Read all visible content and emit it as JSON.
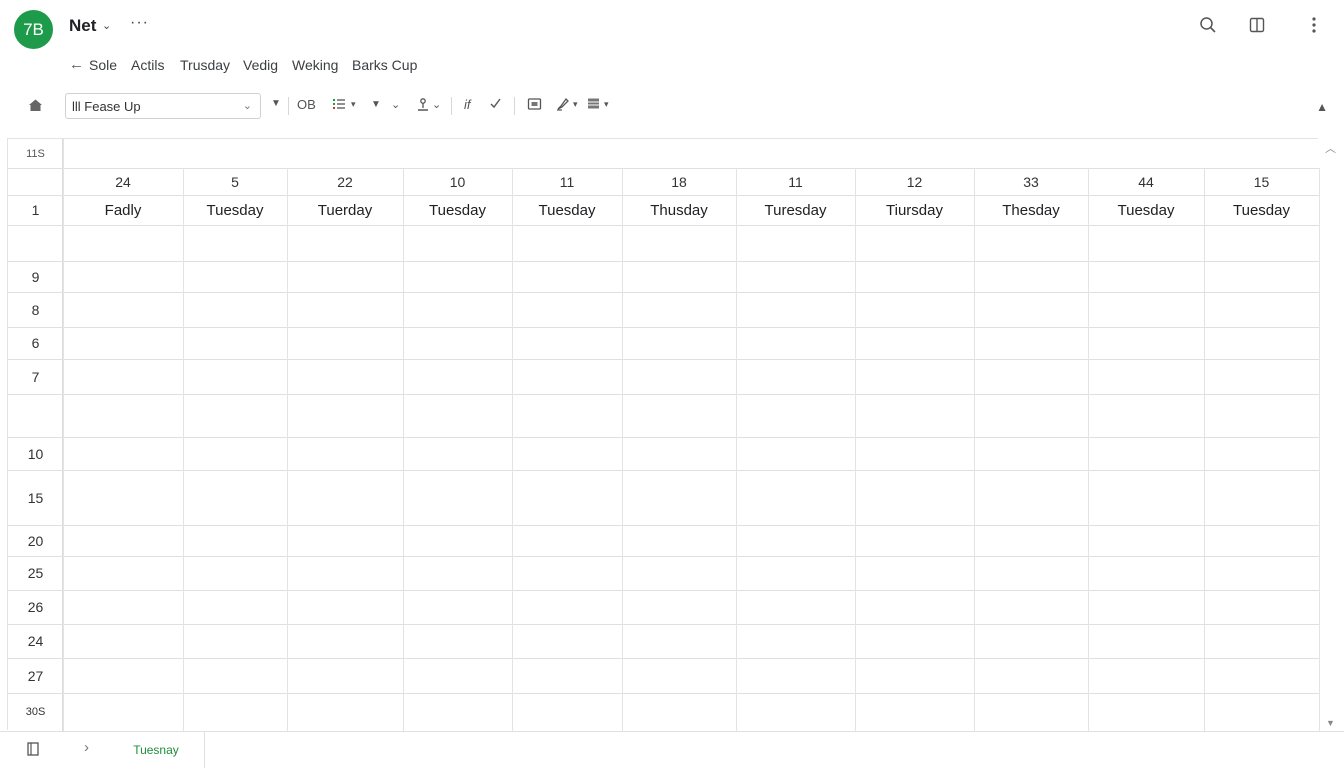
{
  "header": {
    "avatar_text": "7B",
    "app_title": "Net",
    "title_caret": "⌄",
    "more": "···"
  },
  "menu": {
    "back_arrow": "←",
    "items": [
      "Sole",
      "Actils",
      "Trusday",
      "Vedig",
      "Weking",
      "Barks Cup"
    ]
  },
  "toolbar": {
    "font_value": "lll Fease Up",
    "ob_label": "OB",
    "fx_label": "if"
  },
  "grid": {
    "corner": "11S",
    "columns": [
      {
        "num": "24",
        "day": "Fadly"
      },
      {
        "num": "5",
        "day": "Tuesday"
      },
      {
        "num": "22",
        "day": "Tuerday"
      },
      {
        "num": "10",
        "day": "Tuesday"
      },
      {
        "num": "11",
        "day": "Tuesday"
      },
      {
        "num": "18",
        "day": "Thusday"
      },
      {
        "num": "11",
        "day": "Turesday"
      },
      {
        "num": "12",
        "day": "Tiursday"
      },
      {
        "num": "33",
        "day": "Thesday"
      },
      {
        "num": "44",
        "day": "Tuesday"
      },
      {
        "num": "15",
        "day": "Tuesday"
      }
    ],
    "day_row_label": "1",
    "rows": [
      "",
      "9",
      "8",
      "6",
      "7",
      "",
      "10",
      "15",
      "20",
      "25",
      "26",
      "24",
      "27",
      "30S"
    ]
  },
  "sheets": {
    "active_tab": "Tuesnay",
    "nav_arrow": "›"
  },
  "colors": {
    "avatar": "#1e9a4b",
    "active_tab": "#1e8e3e",
    "gridline": "#e0e0e0"
  },
  "icons": [
    "search-icon",
    "split-view-icon",
    "more-vert-icon",
    "home-icon",
    "fill-color-icon",
    "text-color-icon",
    "function-icon",
    "check-icon",
    "image-icon",
    "paint-icon",
    "table-icon",
    "sheet-list-icon"
  ]
}
